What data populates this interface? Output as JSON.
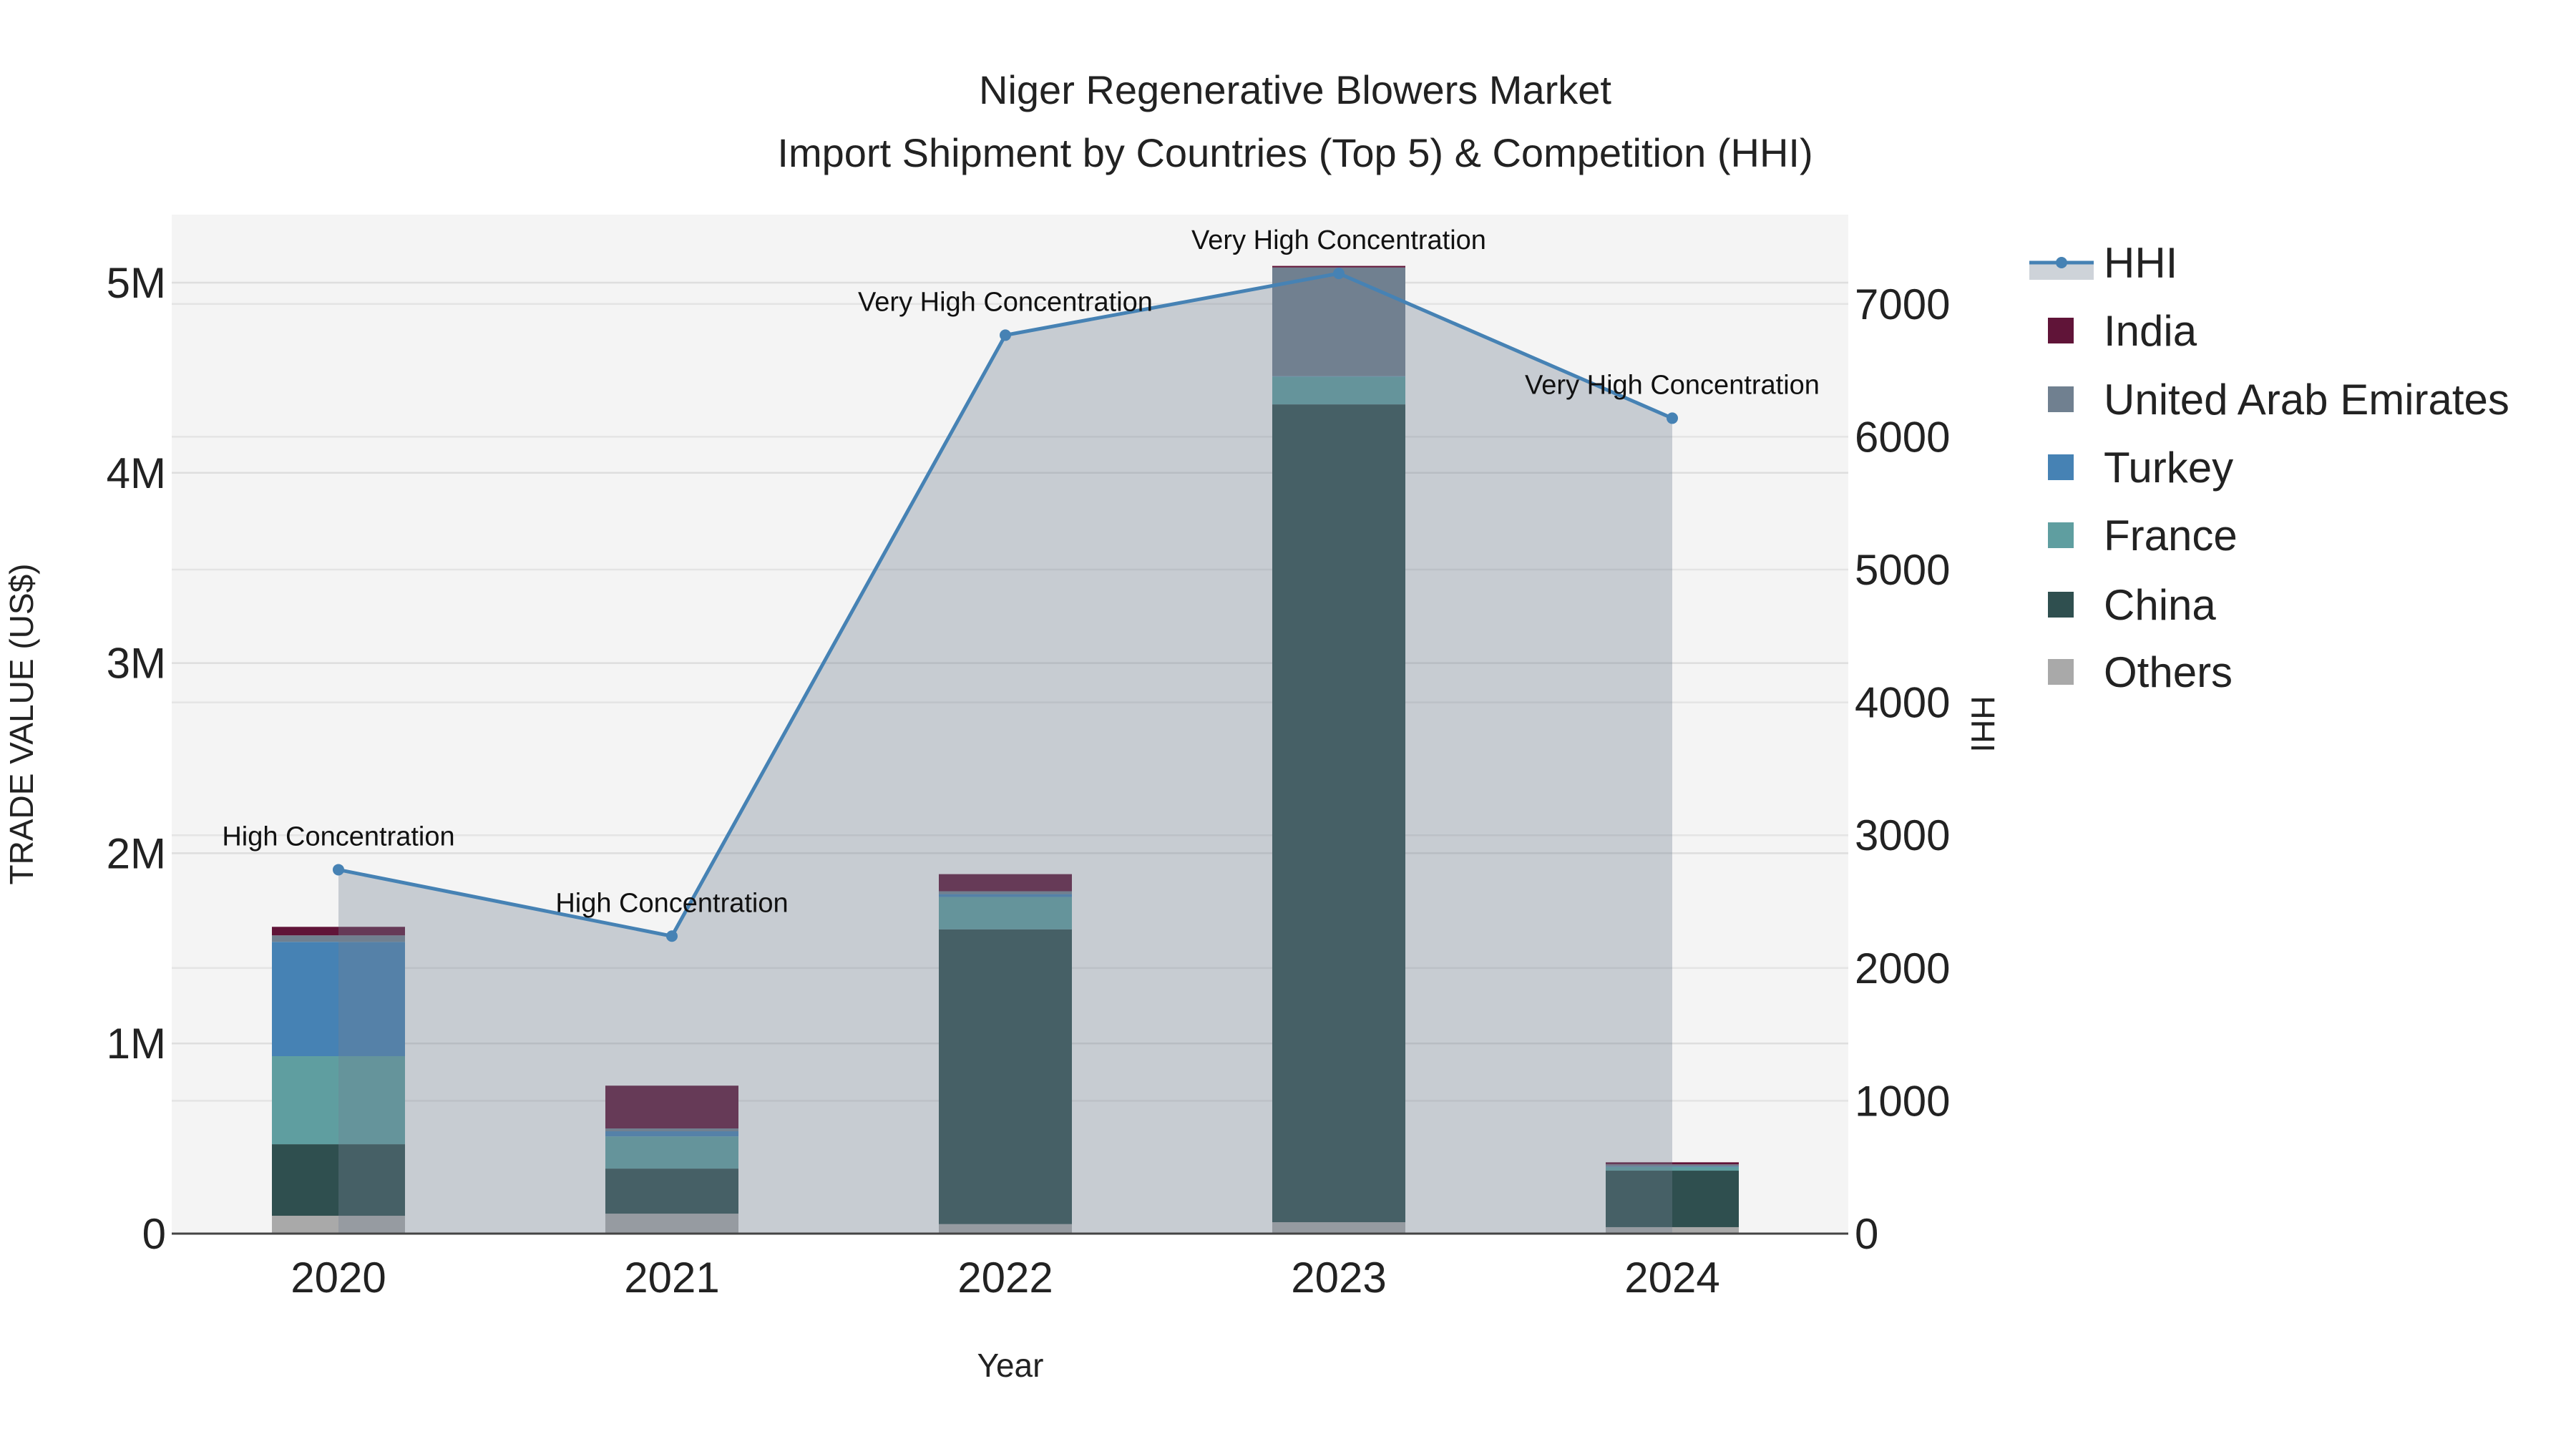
{
  "chart_data": {
    "type": "bar",
    "title": "Niger Regenerative Blowers Market",
    "subtitle": "Import Shipment by Countries (Top 5) & Competition (HHI)",
    "xlabel": "Year",
    "ylabel": "TRADE VALUE (US$)",
    "y2label": "HHI",
    "categories": [
      "2020",
      "2021",
      "2022",
      "2023",
      "2024"
    ],
    "ylim": [
      0,
      5350000
    ],
    "y2lim": [
      0,
      7600
    ],
    "yticks": [
      0,
      1000000,
      2000000,
      3000000,
      4000000,
      5000000
    ],
    "ytick_labels": [
      "0",
      "1M",
      "2M",
      "3M",
      "4M",
      "5M"
    ],
    "y2ticks": [
      0,
      1000,
      2000,
      3000,
      4000,
      5000,
      6000,
      7000
    ],
    "y2tick_labels": [
      "0",
      "1000",
      "2000",
      "3000",
      "4000",
      "5000",
      "6000",
      "7000"
    ],
    "stacked": true,
    "series": [
      {
        "name": "Others",
        "color": "#a9a9a9",
        "values": [
          94000,
          105000,
          50000,
          60000,
          34000
        ]
      },
      {
        "name": "China",
        "color": "#2f4f4f",
        "values": [
          376000,
          237000,
          1550000,
          4300000,
          297000
        ]
      },
      {
        "name": "France",
        "color": "#5f9ea0",
        "values": [
          463000,
          169000,
          170000,
          146000,
          19000
        ]
      },
      {
        "name": "Turkey",
        "color": "#4682b4",
        "values": [
          601000,
          27000,
          15000,
          2000,
          3000
        ]
      },
      {
        "name": "United Arab Emirates",
        "color": "#708090",
        "values": [
          34000,
          15000,
          15000,
          572000,
          11000
        ]
      },
      {
        "name": "India",
        "color": "#601438",
        "values": [
          45000,
          225000,
          90000,
          8000,
          11000
        ]
      }
    ],
    "line": {
      "name": "HHI",
      "axis": "right",
      "color": "#4682b4",
      "values": [
        2740,
        2240,
        6765,
        7230,
        6140
      ],
      "annotations": [
        "High Concentration",
        "High Concentration",
        "Very High Concentration",
        "Very High Concentration",
        "Very High Concentration"
      ]
    },
    "legend": {
      "placement": "right",
      "entries": [
        "HHI",
        "India",
        "United Arab Emirates",
        "Turkey",
        "France",
        "China",
        "Others"
      ]
    },
    "grid": true
  }
}
